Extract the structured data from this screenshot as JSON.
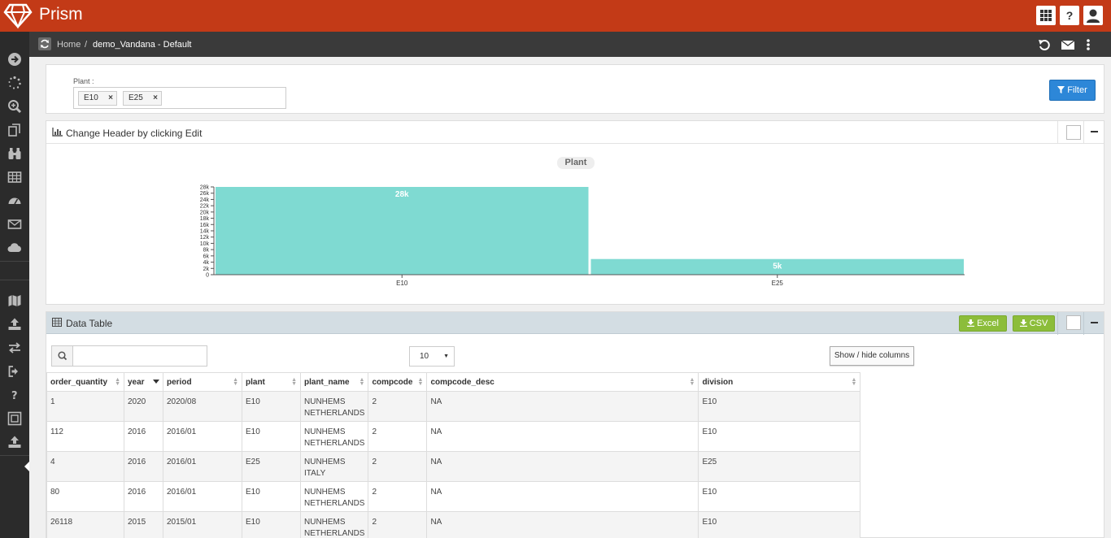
{
  "app": {
    "title": "Prism"
  },
  "breadcrumb": {
    "home": "Home",
    "separator": "/",
    "page": "demo_Vandana - Default"
  },
  "filter": {
    "label": "Plant :",
    "tags": [
      "E10",
      "E25"
    ],
    "remove_glyph": "×",
    "button_label": "Filter"
  },
  "chart_panel": {
    "title": "Change Header by clicking Edit"
  },
  "chart_data": {
    "type": "bar",
    "categories": [
      "E10",
      "E25"
    ],
    "values": [
      28000,
      5000
    ],
    "data_labels": [
      "28k",
      "5k"
    ],
    "legend": [
      "Plant"
    ],
    "legend_placement": "top-center",
    "ylim": [
      0,
      28000
    ],
    "y_ticks": [
      "0",
      "2k",
      "4k",
      "6k",
      "8k",
      "10k",
      "12k",
      "14k",
      "16k",
      "18k",
      "20k",
      "22k",
      "24k",
      "26k",
      "28k"
    ],
    "bar_color": "#7fdad2",
    "grid": false
  },
  "table_panel": {
    "title": "Data Table",
    "excel_label": "Excel",
    "csv_label": "CSV",
    "search_placeholder": "",
    "page_length": "10",
    "colvis_label": "Show / hide columns"
  },
  "table": {
    "columns": [
      "order_quantity",
      "year",
      "period",
      "plant",
      "plant_name",
      "compcode",
      "compcode_desc",
      "division"
    ],
    "rows": [
      [
        "1",
        "2020",
        "2020/08",
        "E10",
        "NUNHEMS NETHERLANDS",
        "2",
        "NA",
        "E10"
      ],
      [
        "112",
        "2016",
        "2016/01",
        "E10",
        "NUNHEMS NETHERLANDS",
        "2",
        "NA",
        "E10"
      ],
      [
        "4",
        "2016",
        "2016/01",
        "E25",
        "NUNHEMS ITALY",
        "2",
        "NA",
        "E25"
      ],
      [
        "80",
        "2016",
        "2016/01",
        "E10",
        "NUNHEMS NETHERLANDS",
        "2",
        "NA",
        "E10"
      ],
      [
        "26118",
        "2015",
        "2015/01",
        "E10",
        "NUNHEMS NETHERLANDS",
        "2",
        "NA",
        "E10"
      ]
    ]
  },
  "colors": {
    "topbar": "#c33a17",
    "crumbbar": "#3a3a3a",
    "sidebar": "#2b2b2b",
    "primary": "#2d87d8",
    "success": "#8cbd3a"
  }
}
